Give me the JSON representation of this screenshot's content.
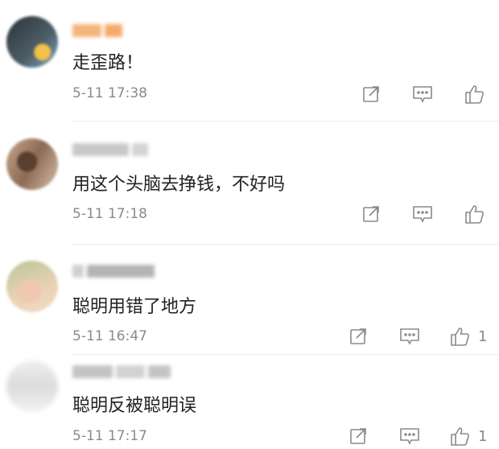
{
  "comments": [
    {
      "text": "走歪路！",
      "time": "5-11 17:38",
      "like_count": "",
      "avatar_color": "#3c4a52",
      "avatar_accent": "#f2c14a",
      "name_color": "#f5b47a"
    },
    {
      "text": "用这个头脑去挣钱，不好吗",
      "time": "5-11 17:18",
      "like_count": "",
      "avatar_color": "#b09078",
      "avatar_accent": "#5a3e2e",
      "name_color": "#c8c8c8"
    },
    {
      "text": "聪明用错了地方",
      "time": "5-11 16:47",
      "like_count": "1",
      "avatar_color": "#e8d0b4",
      "avatar_accent": "#b8c898",
      "name_color": "#b4b4b4"
    },
    {
      "text": "聪明反被聪明误",
      "time": "5-11 17:17",
      "like_count": "1",
      "avatar_color": "#e4e4e4",
      "avatar_accent": "#c8c8c8",
      "name_color": "#c4c4c4"
    }
  ],
  "icons": {
    "share": "share-icon",
    "comment": "comment-icon",
    "like": "thumbs-up-icon"
  },
  "colors": {
    "text": "#222222",
    "meta": "#8a8a8a",
    "icon": "#8a8a8a"
  }
}
